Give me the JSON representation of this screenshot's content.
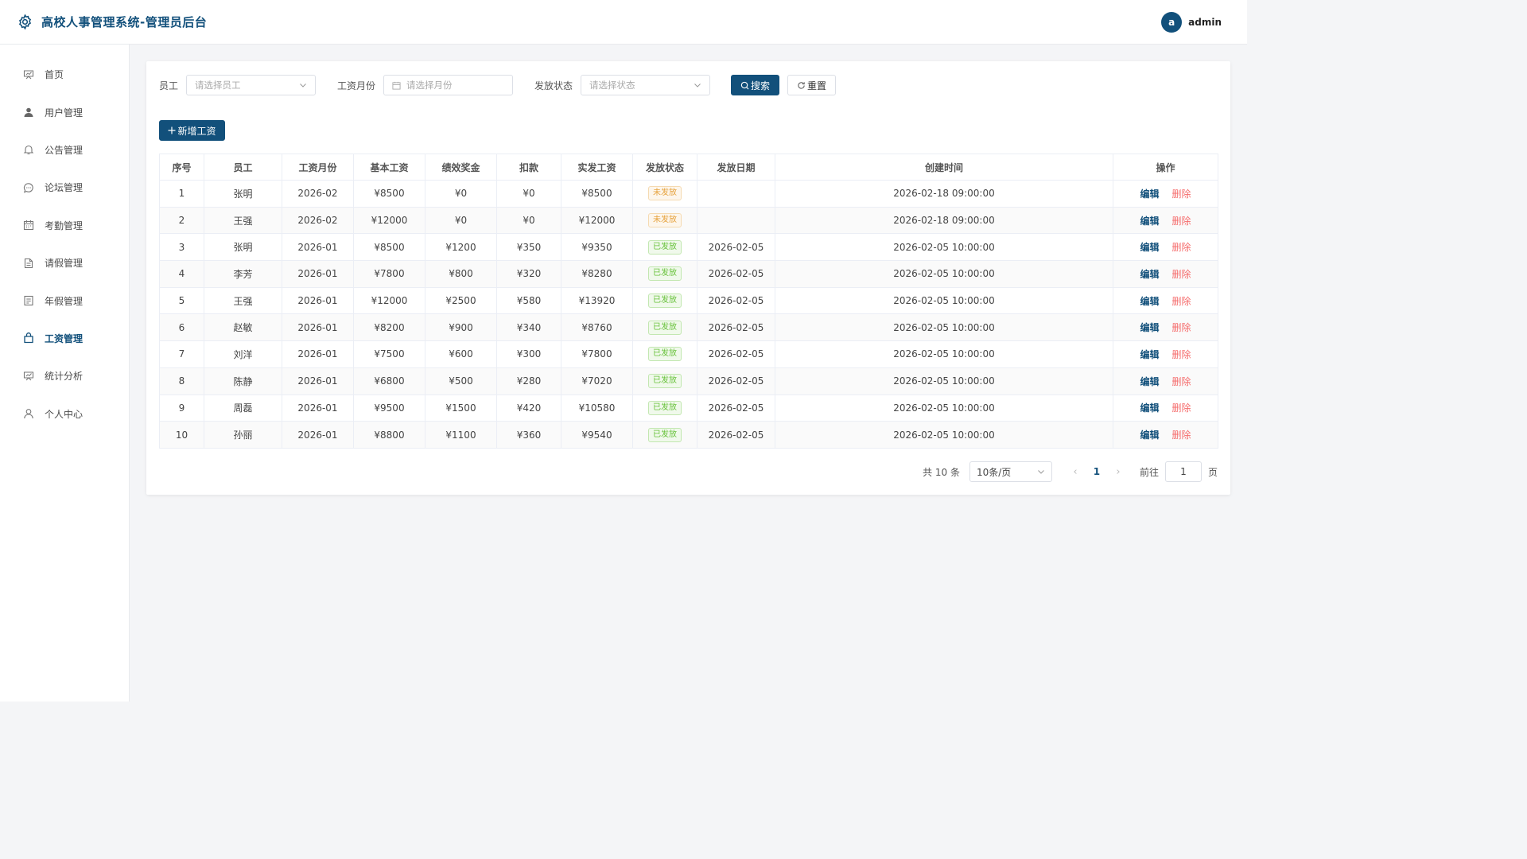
{
  "app": {
    "title": "高校人事管理系统-管理员后台",
    "avatar_letter": "a",
    "username": "admin",
    "accent_color": "#12507b"
  },
  "sidebar": {
    "items": [
      {
        "label": "首页",
        "icon": "chart-icon"
      },
      {
        "label": "用户管理",
        "icon": "user-icon"
      },
      {
        "label": "公告管理",
        "icon": "bell-icon"
      },
      {
        "label": "论坛管理",
        "icon": "chat-icon"
      },
      {
        "label": "考勤管理",
        "icon": "calendar-icon"
      },
      {
        "label": "请假管理",
        "icon": "document-icon"
      },
      {
        "label": "年假管理",
        "icon": "list-icon"
      },
      {
        "label": "工资管理",
        "icon": "wallet-icon",
        "active": true
      },
      {
        "label": "统计分析",
        "icon": "chart-icon"
      },
      {
        "label": "个人中心",
        "icon": "user-outline-icon"
      }
    ]
  },
  "filters": {
    "employee_label": "员工",
    "employee_placeholder": "请选择员工",
    "month_label": "工资月份",
    "month_placeholder": "请选择月份",
    "status_label": "发放状态",
    "status_placeholder": "请选择状态",
    "search_label": "搜索",
    "reset_label": "重置"
  },
  "toolbar": {
    "add_label": "新增工资"
  },
  "table": {
    "columns": [
      "序号",
      "员工",
      "工资月份",
      "基本工资",
      "绩效奖金",
      "扣款",
      "实发工资",
      "发放状态",
      "发放日期",
      "创建时间",
      "操作"
    ],
    "edit_label": "编辑",
    "delete_label": "删除",
    "rows": [
      {
        "no": "1",
        "employee": "张明",
        "month": "2026-02",
        "base": "¥8500",
        "bonus": "¥0",
        "deduction": "¥0",
        "net": "¥8500",
        "status": "未发放",
        "status_type": "pending",
        "pay_date": "",
        "created": "2026-02-18 09:00:00"
      },
      {
        "no": "2",
        "employee": "王强",
        "month": "2026-02",
        "base": "¥12000",
        "bonus": "¥0",
        "deduction": "¥0",
        "net": "¥12000",
        "status": "未发放",
        "status_type": "pending",
        "pay_date": "",
        "created": "2026-02-18 09:00:00"
      },
      {
        "no": "3",
        "employee": "张明",
        "month": "2026-01",
        "base": "¥8500",
        "bonus": "¥1200",
        "deduction": "¥350",
        "net": "¥9350",
        "status": "已发放",
        "status_type": "paid",
        "pay_date": "2026-02-05",
        "created": "2026-02-05 10:00:00"
      },
      {
        "no": "4",
        "employee": "李芳",
        "month": "2026-01",
        "base": "¥7800",
        "bonus": "¥800",
        "deduction": "¥320",
        "net": "¥8280",
        "status": "已发放",
        "status_type": "paid",
        "pay_date": "2026-02-05",
        "created": "2026-02-05 10:00:00"
      },
      {
        "no": "5",
        "employee": "王强",
        "month": "2026-01",
        "base": "¥12000",
        "bonus": "¥2500",
        "deduction": "¥580",
        "net": "¥13920",
        "status": "已发放",
        "status_type": "paid",
        "pay_date": "2026-02-05",
        "created": "2026-02-05 10:00:00"
      },
      {
        "no": "6",
        "employee": "赵敏",
        "month": "2026-01",
        "base": "¥8200",
        "bonus": "¥900",
        "deduction": "¥340",
        "net": "¥8760",
        "status": "已发放",
        "status_type": "paid",
        "pay_date": "2026-02-05",
        "created": "2026-02-05 10:00:00"
      },
      {
        "no": "7",
        "employee": "刘洋",
        "month": "2026-01",
        "base": "¥7500",
        "bonus": "¥600",
        "deduction": "¥300",
        "net": "¥7800",
        "status": "已发放",
        "status_type": "paid",
        "pay_date": "2026-02-05",
        "created": "2026-02-05 10:00:00"
      },
      {
        "no": "8",
        "employee": "陈静",
        "month": "2026-01",
        "base": "¥6800",
        "bonus": "¥500",
        "deduction": "¥280",
        "net": "¥7020",
        "status": "已发放",
        "status_type": "paid",
        "pay_date": "2026-02-05",
        "created": "2026-02-05 10:00:00"
      },
      {
        "no": "9",
        "employee": "周磊",
        "month": "2026-01",
        "base": "¥9500",
        "bonus": "¥1500",
        "deduction": "¥420",
        "net": "¥10580",
        "status": "已发放",
        "status_type": "paid",
        "pay_date": "2026-02-05",
        "created": "2026-02-05 10:00:00"
      },
      {
        "no": "10",
        "employee": "孙丽",
        "month": "2026-01",
        "base": "¥8800",
        "bonus": "¥1100",
        "deduction": "¥360",
        "net": "¥9540",
        "status": "已发放",
        "status_type": "paid",
        "pay_date": "2026-02-05",
        "created": "2026-02-05 10:00:00"
      }
    ]
  },
  "pagination": {
    "total_text": "共 10 条",
    "page_size": "10条/页",
    "current_page": "1",
    "goto_label": "前往",
    "goto_value": "1",
    "page_suffix": "页"
  }
}
